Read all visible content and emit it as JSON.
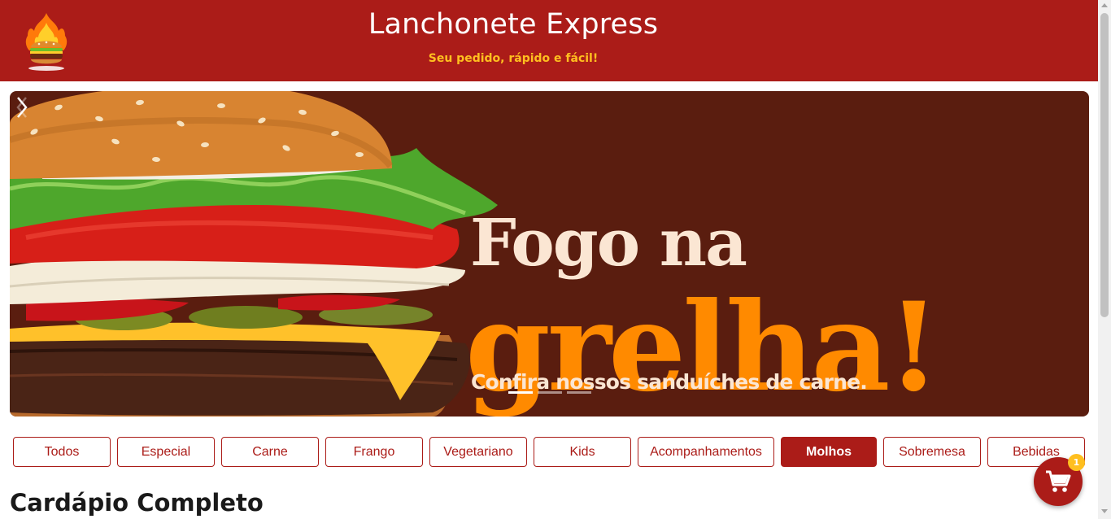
{
  "header": {
    "title": "Lanchonete Express",
    "subtitle": "Seu pedido, rápido e fácil!",
    "logo_icon": "flaming-burger-logo"
  },
  "banner": {
    "headline_line1": "Fogo na",
    "headline_line2": "grelha!",
    "tagline": "Confira nossos sanduíches de carne.",
    "slide_count": 3,
    "active_slide": 1,
    "prev_icon": "chevron-left-icon",
    "next_icon": "chevron-right-icon"
  },
  "categories": [
    {
      "label": "Todos",
      "active": false
    },
    {
      "label": "Especial",
      "active": false
    },
    {
      "label": "Carne",
      "active": false
    },
    {
      "label": "Frango",
      "active": false
    },
    {
      "label": "Vegetariano",
      "active": false
    },
    {
      "label": "Kids",
      "active": false
    },
    {
      "label": "Acompanhamentos",
      "active": false
    },
    {
      "label": "Molhos",
      "active": true
    },
    {
      "label": "Sobremesa",
      "active": false
    },
    {
      "label": "Bebidas",
      "active": false
    }
  ],
  "section": {
    "title": "Cardápio Completo"
  },
  "cart": {
    "icon": "shopping-cart-icon",
    "count": "1"
  },
  "colors": {
    "brand_red": "#ab1c18",
    "accent_yellow": "#ffbf1f",
    "banner_bg": "#5a1d0f",
    "headline_cream": "#fbe6d3",
    "headline_orange": "#ff8a00"
  }
}
